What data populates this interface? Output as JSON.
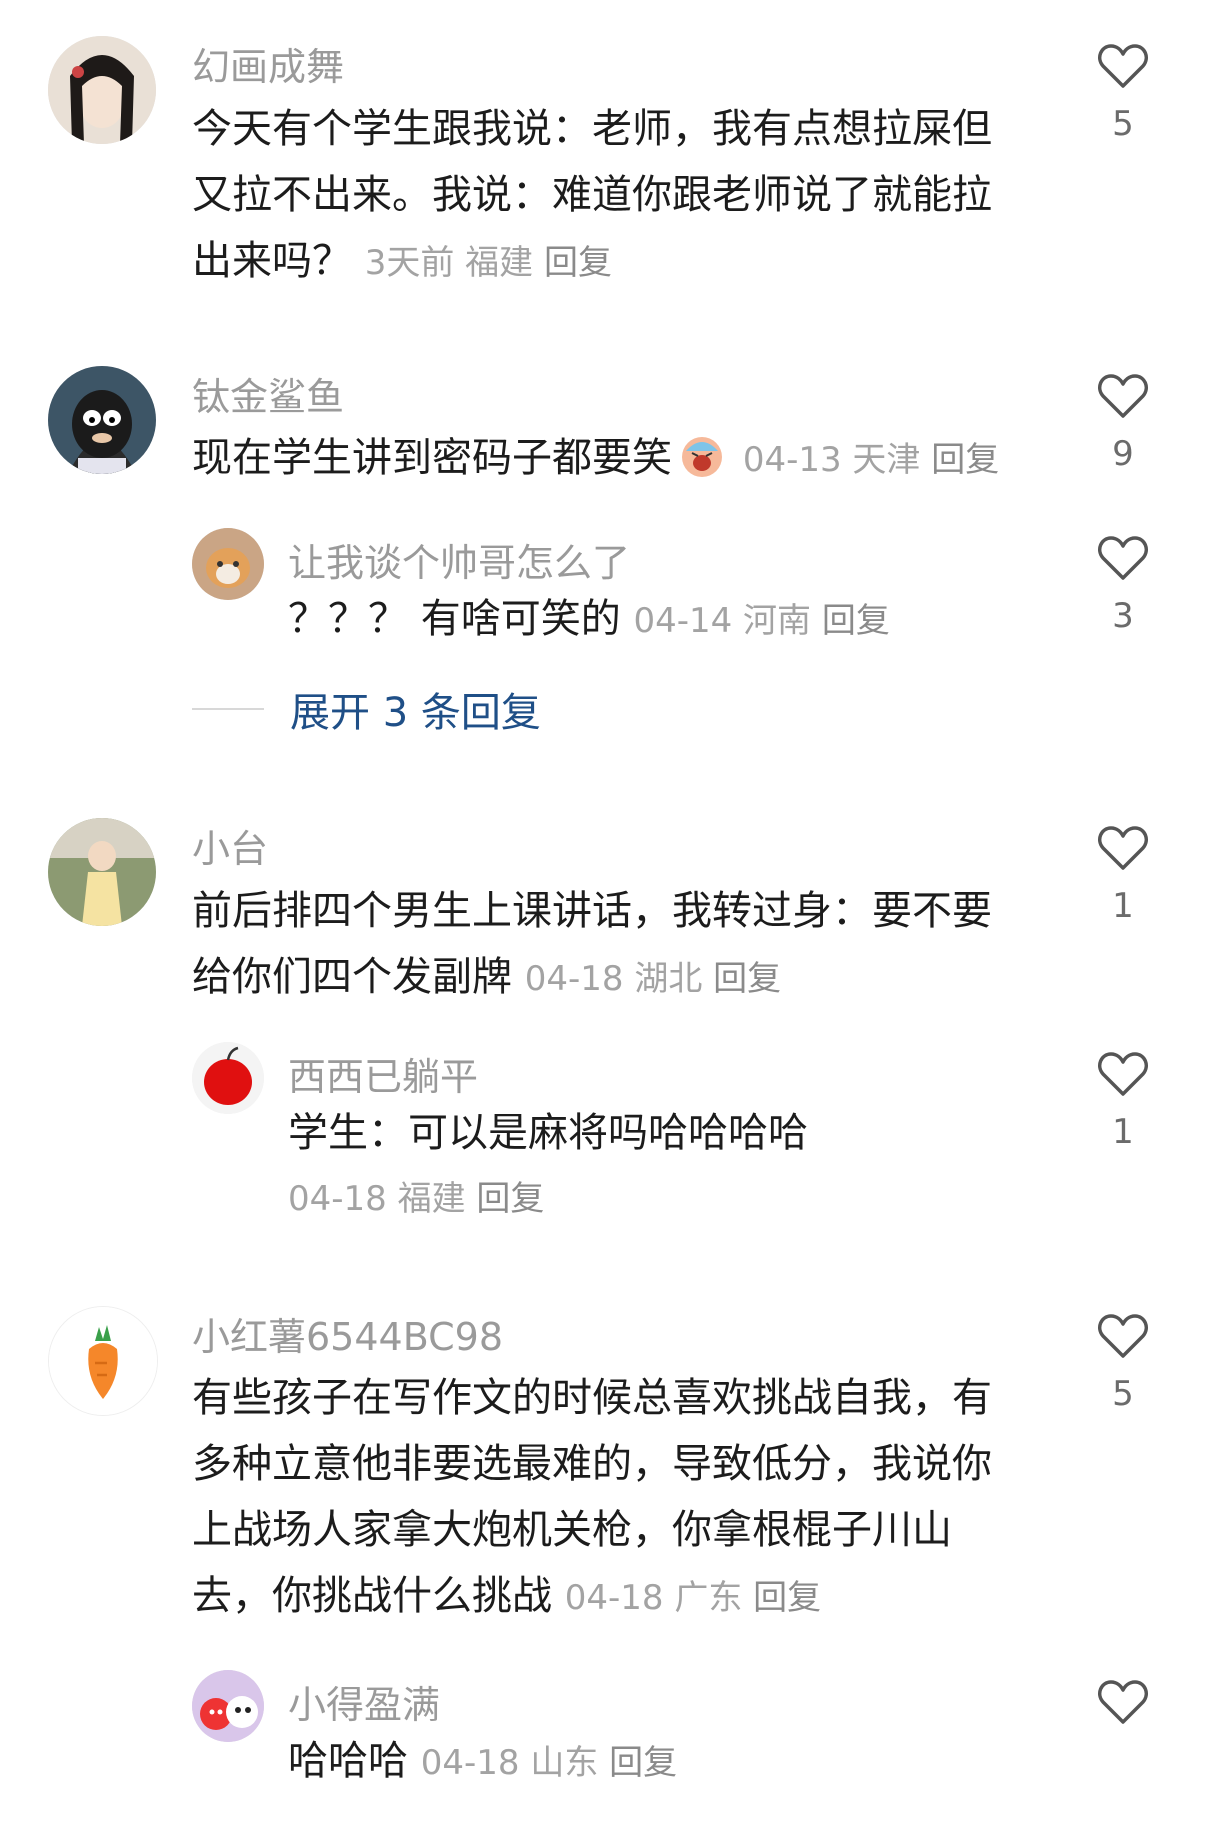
{
  "comments": [
    {
      "user": "幻画成舞",
      "text_lines": [
        "今天有个学生跟我说：老师，我有点想拉屎但",
        "又拉不出来。我说：难道你跟老师说了就能拉",
        "出来吗？"
      ],
      "time": "3天前",
      "location": "福建",
      "reply": "回复",
      "likes": "5"
    },
    {
      "user": "钛金鲨鱼",
      "text_lines": [
        "现在学生讲到密码子都要笑"
      ],
      "emoji": "😨",
      "time": "04-13",
      "location": "天津",
      "reply": "回复",
      "likes": "9",
      "replies": [
        {
          "user": "让我谈个帅哥怎么了",
          "text": "？？？ 有啥可笑的",
          "time": "04-14",
          "location": "河南",
          "reply": "回复",
          "likes": "3"
        }
      ],
      "expand_label": "展开 3 条回复"
    },
    {
      "user": "小台",
      "text_lines": [
        "前后排四个男生上课讲话，我转过身：要不要",
        "给你们四个发副牌"
      ],
      "time": "04-18",
      "location": "湖北",
      "reply": "回复",
      "likes": "1",
      "replies": [
        {
          "user": "西西已躺平",
          "text": "学生：可以是麻将吗哈哈哈哈",
          "time": "04-18",
          "location": "福建",
          "reply": "回复",
          "likes": "1"
        }
      ]
    },
    {
      "user": "小红薯6544BC98",
      "text_lines": [
        "有些孩子在写作文的时候总喜欢挑战自我，有",
        "多种立意他非要选最难的，导致低分，我说你",
        "上战场人家拿大炮机关枪，你拿根棍子",
        "去，你挑战什么挑战"
      ],
      "inline_marks": "川山",
      "time": "04-18",
      "location": "广东",
      "reply": "回复",
      "likes": "5",
      "replies": [
        {
          "user": "小得盈满",
          "text": "哈哈哈",
          "time": "04-18",
          "location": "山东",
          "reply": "回复",
          "likes": ""
        }
      ]
    }
  ],
  "icons": {
    "like": "heart-outline-icon"
  },
  "colors": {
    "name": "#9a9a9a",
    "meta": "#a3a3a3",
    "expand": "#1f4f87",
    "text": "#1c1c1c"
  }
}
